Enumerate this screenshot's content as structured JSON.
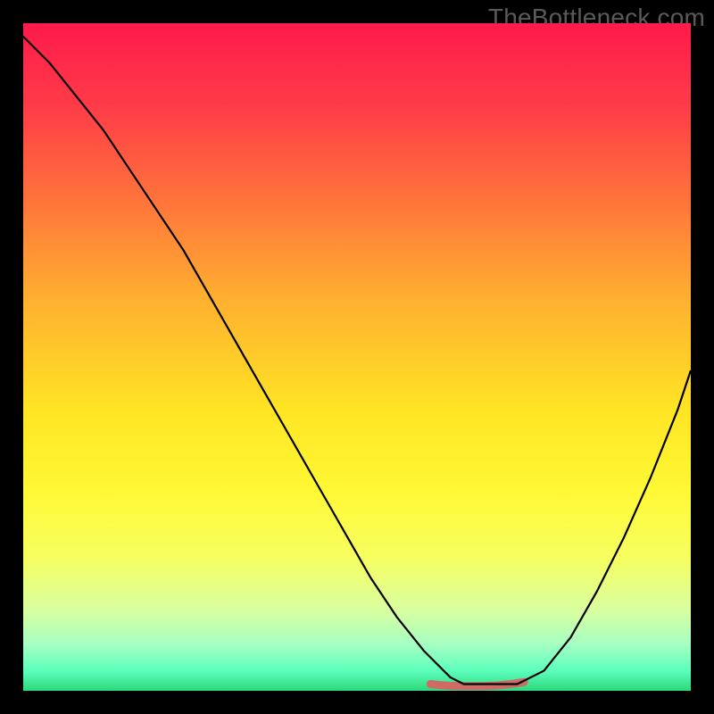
{
  "watermark": "TheBottleneck.com",
  "chart_data": {
    "type": "line",
    "title": "",
    "xlabel": "",
    "ylabel": "",
    "xlim": [
      0,
      100
    ],
    "ylim": [
      0,
      100
    ],
    "grid": false,
    "background_gradient": {
      "stops": [
        {
          "offset": 0.0,
          "color": "#ff1a4b"
        },
        {
          "offset": 0.12,
          "color": "#ff3a48"
        },
        {
          "offset": 0.28,
          "color": "#ff7a3a"
        },
        {
          "offset": 0.42,
          "color": "#ffb22f"
        },
        {
          "offset": 0.58,
          "color": "#ffe524"
        },
        {
          "offset": 0.7,
          "color": "#fff835"
        },
        {
          "offset": 0.8,
          "color": "#f7ff60"
        },
        {
          "offset": 0.88,
          "color": "#d8ffa0"
        },
        {
          "offset": 0.93,
          "color": "#a6ffc2"
        },
        {
          "offset": 0.97,
          "color": "#5cffbc"
        },
        {
          "offset": 1.0,
          "color": "#2cd97a"
        }
      ]
    },
    "series": [
      {
        "name": "bottleneck-curve",
        "color": "#000000",
        "width": 2.2,
        "x": [
          0,
          4,
          8,
          12,
          16,
          20,
          24,
          28,
          32,
          36,
          40,
          44,
          48,
          52,
          56,
          60,
          64,
          66,
          70,
          74,
          78,
          82,
          86,
          90,
          94,
          98,
          100
        ],
        "y": [
          98,
          94,
          89,
          84,
          78,
          72,
          66,
          59,
          52,
          45,
          38,
          31,
          24,
          17,
          11,
          6,
          2,
          1,
          1,
          1,
          3,
          8,
          15,
          23,
          32,
          42,
          48
        ]
      }
    ],
    "valley_marker": {
      "color": "#cf6a66",
      "width": 9,
      "x": [
        61,
        63,
        65,
        67,
        69,
        71,
        73,
        75
      ],
      "y": [
        1.0,
        0.8,
        0.7,
        0.7,
        0.7,
        0.8,
        1.0,
        1.3
      ]
    }
  }
}
